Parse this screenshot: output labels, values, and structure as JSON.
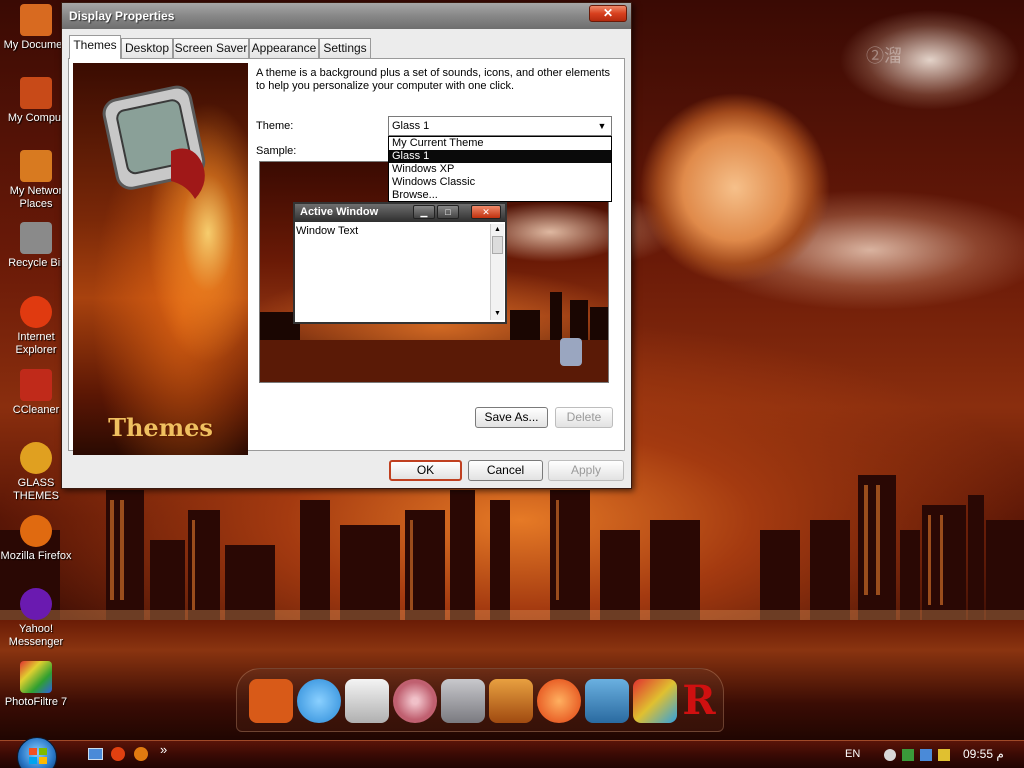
{
  "desktop": {
    "icons": [
      {
        "label": "My Documen",
        "color": "#d86a20"
      },
      {
        "label": "My Comput",
        "color": "#c84a18"
      },
      {
        "label": "My Networ Places",
        "color": "#d87a20"
      },
      {
        "label": "Recycle Bir",
        "color": "#8a8a8a"
      },
      {
        "label": "Internet Explorer",
        "color": "#e03a10"
      },
      {
        "label": "CCleaner",
        "color": "#c02a1a"
      },
      {
        "label": "GLASS THEMES",
        "color": "#e0a020"
      },
      {
        "label": "Mozilla Firefox",
        "color": "#e06a10"
      },
      {
        "label": "Yahoo! Messenger",
        "color": "#6a1ab0"
      },
      {
        "label": "PhotoFiltre 7",
        "color": "#30a030"
      }
    ],
    "watermark": "②溜"
  },
  "dialog": {
    "title": "Display Properties",
    "close_glyph": "✕",
    "tabs": [
      "Themes",
      "Desktop",
      "Screen Saver",
      "Appearance",
      "Settings"
    ],
    "banner_title": "Themes",
    "description": "A theme is a background plus a set of sounds, icons, and other elements to help you personalize your computer with one click.",
    "theme_label": "Theme:",
    "theme_value": "Glass 1",
    "theme_options": [
      "My Current Theme",
      "Glass 1",
      "Windows XP",
      "Windows Classic",
      "Browse..."
    ],
    "selected_option": "Glass 1",
    "sample_label": "Sample:",
    "sample": {
      "window_title": "Active Window",
      "window_text": "Window Text"
    },
    "save_as_label": "Save As...",
    "delete_label": "Delete",
    "ok_label": "OK",
    "cancel_label": "Cancel",
    "apply_label": "Apply"
  },
  "dock": {
    "items": [
      "my-computer-icon",
      "windows-logo-icon",
      "drive-icon",
      "disc-icon",
      "recycle-bin-icon",
      "picture-icon",
      "internet-explorer-icon",
      "laptop-icon",
      "paint-icon",
      "r-logo-icon"
    ],
    "colors": [
      "#d85a18",
      "#2a8ad8",
      "#e0e0e0",
      "#c06070",
      "#9a9aa0",
      "#e8a040",
      "#e04010",
      "#3a8ac8",
      "#e07a30",
      "#d01010"
    ],
    "r_glyph": "R"
  },
  "taskbar": {
    "quick_launch_more": "»",
    "language": "EN",
    "clock": "09:55",
    "clock_suffix": "م"
  },
  "colors": {
    "accent": "#c04020",
    "title_bar": "#8a8a8a"
  }
}
